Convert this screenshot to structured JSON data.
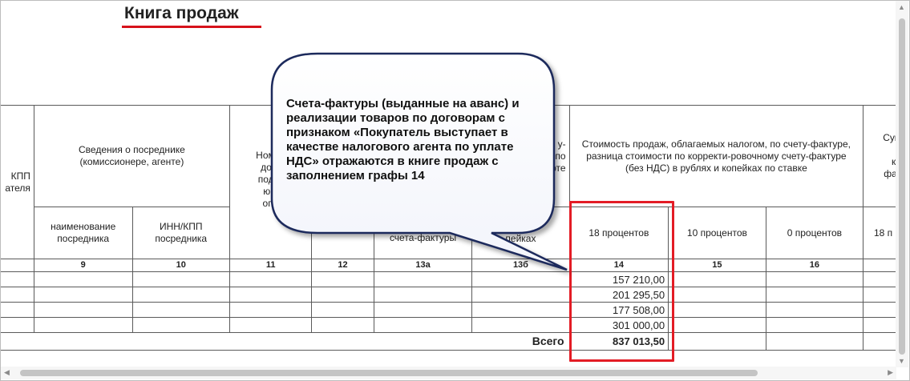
{
  "title": "Книга продаж",
  "header": {
    "col_left_fragment": "КПП\nателя",
    "intermediary_group": "Сведения о посреднике\n(комиссионере, агенте)",
    "intermediary_name": "наименование\nпосредника",
    "intermediary_inn": "ИНН/КПП\nпосредника",
    "col11_fragment": "Номер\nдоку\nподтв\nющ\nопл",
    "col13a_fragment": "счета-фактуры",
    "col13b_fragment_top": "у-\nпо\nоюте",
    "col13b_fragment_bottom": "рублях и\nпейках",
    "sales_value_group": "Стоимость продаж, облагаемых налогом, по счету-фактуре, разница стоимости по корректи-ровочному счету-фактуре (без НДС) в рублях и копейках по ставке",
    "rate_18": "18 процентов",
    "rate_10": "10 процентов",
    "rate_0": "0 процентов",
    "right_group_fragment": "Сум\nр\nко\nфак",
    "right_rate_fragment": "18 п"
  },
  "column_numbers": [
    "9",
    "10",
    "11",
    "12",
    "13а",
    "13б",
    "14",
    "15",
    "16"
  ],
  "rows": [
    {
      "col14": "157 210,00"
    },
    {
      "col14": "201 295,50"
    },
    {
      "col14": "177 508,00"
    },
    {
      "col14": "301 000,00"
    }
  ],
  "total": {
    "label": "Всего",
    "value": "837 013,50"
  },
  "callout": {
    "text": "Счета-фактуры (выданные на аванс) и реализации товаров по договорам с признаком «Покупатель выступает в качестве налогового агента по уплате НДС» отражаются в книге продаж с заполнением графы 14"
  },
  "colors": {
    "highlight": "#e31c25",
    "callout_border": "#1f2a5c",
    "title_underline": "#d6121b"
  }
}
